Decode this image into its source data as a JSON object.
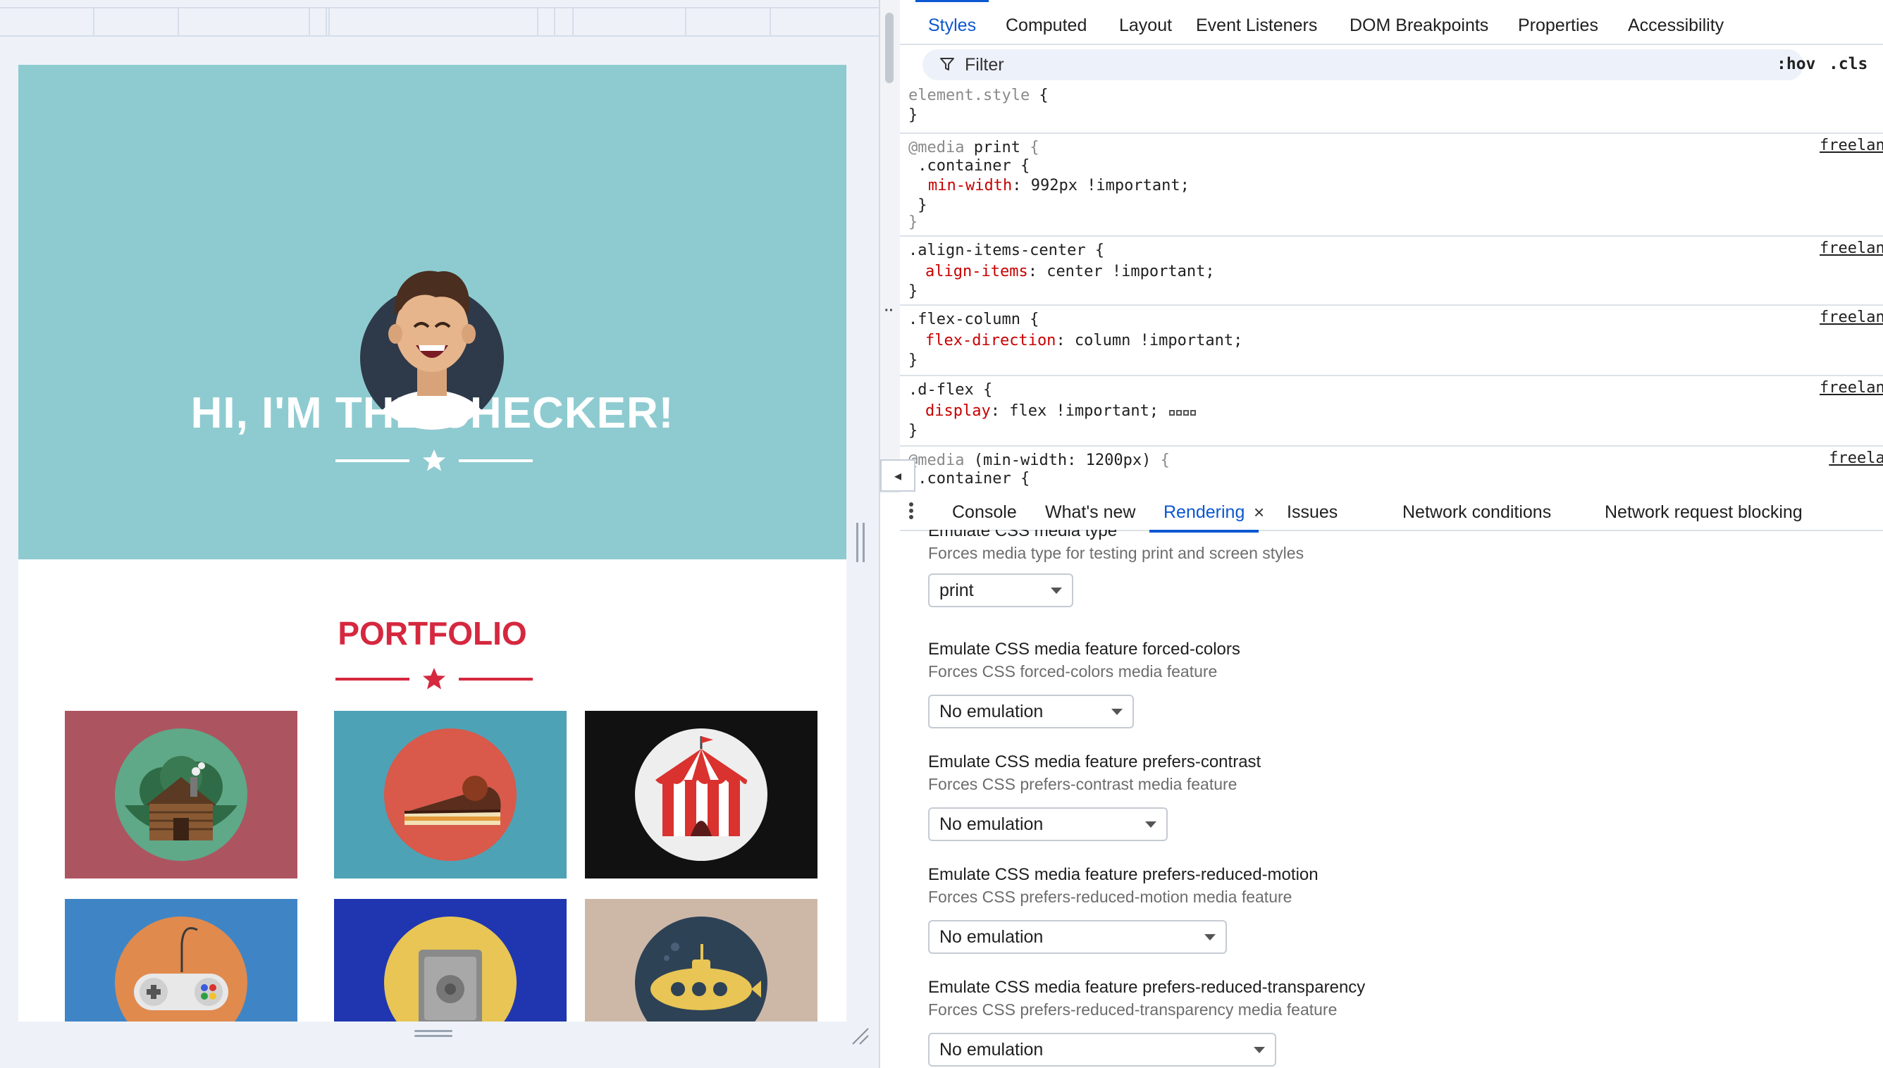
{
  "preview": {
    "hero": {
      "title": "HI, I'M THE CHECKER!",
      "background": "#8ecbd0"
    },
    "portfolio": {
      "title": "PORTFOLIO",
      "accent": "#d5283f",
      "tiles": [
        {
          "icon": "log-cabin-icon",
          "background": "#ad5461"
        },
        {
          "icon": "cake-slice-icon",
          "background": "#4ea2b6"
        },
        {
          "icon": "circus-tent-icon",
          "background": "#111111"
        },
        {
          "icon": "game-controller-icon",
          "background": "#3f85c5"
        },
        {
          "icon": "safe-icon",
          "background": "#2036b0"
        },
        {
          "icon": "submarine-icon",
          "background": "#cdb8a8"
        }
      ]
    }
  },
  "devtools": {
    "styles_tabs": [
      "Styles",
      "Computed",
      "Layout",
      "Event Listeners",
      "DOM Breakpoints",
      "Properties",
      "Accessibility"
    ],
    "filter_placeholder": "Filter",
    "hov": ":hov",
    "cls": ".cls",
    "rules": {
      "element_style": {
        "selector": "element.style",
        "open": " {",
        "close": "}"
      },
      "media_print": {
        "at": "@media",
        "query": " print ",
        "brace": "{",
        "selector": " .container {",
        "prop": "min-width",
        "value": ": 992px !important;",
        "close_inner": " }",
        "close": "}",
        "source": "freelanc"
      },
      "align": {
        "selector": ".align-items-center {",
        "prop": "align-items",
        "value": ": center !important;",
        "close": "}",
        "source": "freelanc"
      },
      "flexcol": {
        "selector": ".flex-column {",
        "prop": "flex-direction",
        "value": ": column !important;",
        "close": "}",
        "source": "freelanc"
      },
      "dflex": {
        "selector": ".d-flex {",
        "prop": "display",
        "value": ": flex !important;",
        "close": "}",
        "source": "freelanc"
      },
      "media_1200": {
        "at": "@media",
        "query": " (min-width: 1200px) ",
        "brace": "{",
        "selector": " .container {",
        "source": "freelar"
      }
    },
    "drawer_tabs": [
      "Console",
      "What's new",
      "Rendering",
      "Issues",
      "Network conditions",
      "Network request blocking"
    ],
    "drawer_close": "×",
    "rendering": {
      "media_type": {
        "heading": "Emulate CSS media type",
        "desc": "Forces media type for testing print and screen styles",
        "value": "print"
      },
      "forced_colors": {
        "heading": "Emulate CSS media feature forced-colors",
        "desc": "Forces CSS forced-colors media feature",
        "value": "No emulation"
      },
      "prefers_contrast": {
        "heading": "Emulate CSS media feature prefers-contrast",
        "desc": "Forces CSS prefers-contrast media feature",
        "value": "No emulation"
      },
      "reduced_motion": {
        "heading": "Emulate CSS media feature prefers-reduced-motion",
        "desc": "Forces CSS prefers-reduced-motion media feature",
        "value": "No emulation"
      },
      "reduced_transparency": {
        "heading": "Emulate CSS media feature prefers-reduced-transparency",
        "desc": "Forces CSS prefers-reduced-transparency media feature",
        "value": "No emulation"
      }
    },
    "accent": "#0b57d0"
  }
}
